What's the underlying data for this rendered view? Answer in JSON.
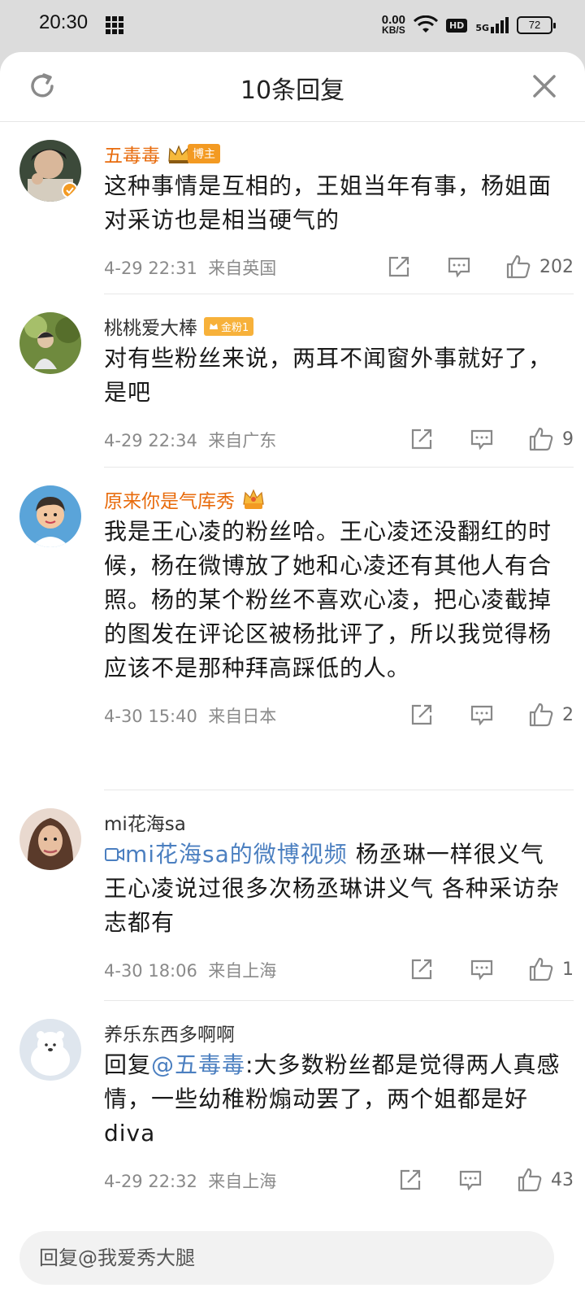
{
  "status_bar": {
    "time": "20:30",
    "net_speed_value": "0.00",
    "net_speed_unit": "KB/S",
    "hd_label": "HD",
    "network_label": "5G",
    "battery": "72"
  },
  "header": {
    "title": "10条回复"
  },
  "comments": [
    {
      "user": "五毒毒",
      "badge": "博主",
      "text": "这种事情是互相的，王姐当年有事，杨姐面对采访也是相当硬气的",
      "time": "4-29 22:31",
      "location": "来自英国",
      "likes": "202"
    },
    {
      "user": "桃桃爱大棒",
      "badge": "金粉1",
      "text": "对有些粉丝来说，两耳不闻窗外事就好了，是吧",
      "time": "4-29 22:34",
      "location": "来自广东",
      "likes": "9"
    },
    {
      "user": "原来你是气库秀",
      "text": "我是王心凌的粉丝哈。王心凌还没翻红的时候，杨在微博放了她和心凌还有其他人有合照。杨的某个粉丝不喜欢心凌，把心凌截掉的图发在评论区被杨批评了，所以我觉得杨应该不是那种拜高踩低的人。",
      "time": "4-30 15:40",
      "location": "来自日本",
      "likes": "2"
    },
    {
      "user": "mi花海sa",
      "link": "mi花海sa的微博视频",
      "text": " 杨丞琳一样很义气 王心凌说过很多次杨丞琳讲义气 各种采访杂志都有",
      "time": "4-30 18:06",
      "location": "来自上海",
      "likes": "1"
    },
    {
      "user": "养乐东西多啊啊",
      "reply_prefix": "回复",
      "mention": "@五毒毒",
      "text": ":大多数粉丝都是觉得两人真感情，一些幼稚粉煽动罢了，两个姐都是好diva",
      "time": "4-29 22:32",
      "location": "来自上海",
      "likes": "43"
    }
  ],
  "reply_bar": {
    "placeholder": "回复@我爱秀大腿"
  },
  "colors": {
    "orange_name": "#e86b0c",
    "link": "#4b7fc0",
    "meta": "#8a8a8a"
  }
}
